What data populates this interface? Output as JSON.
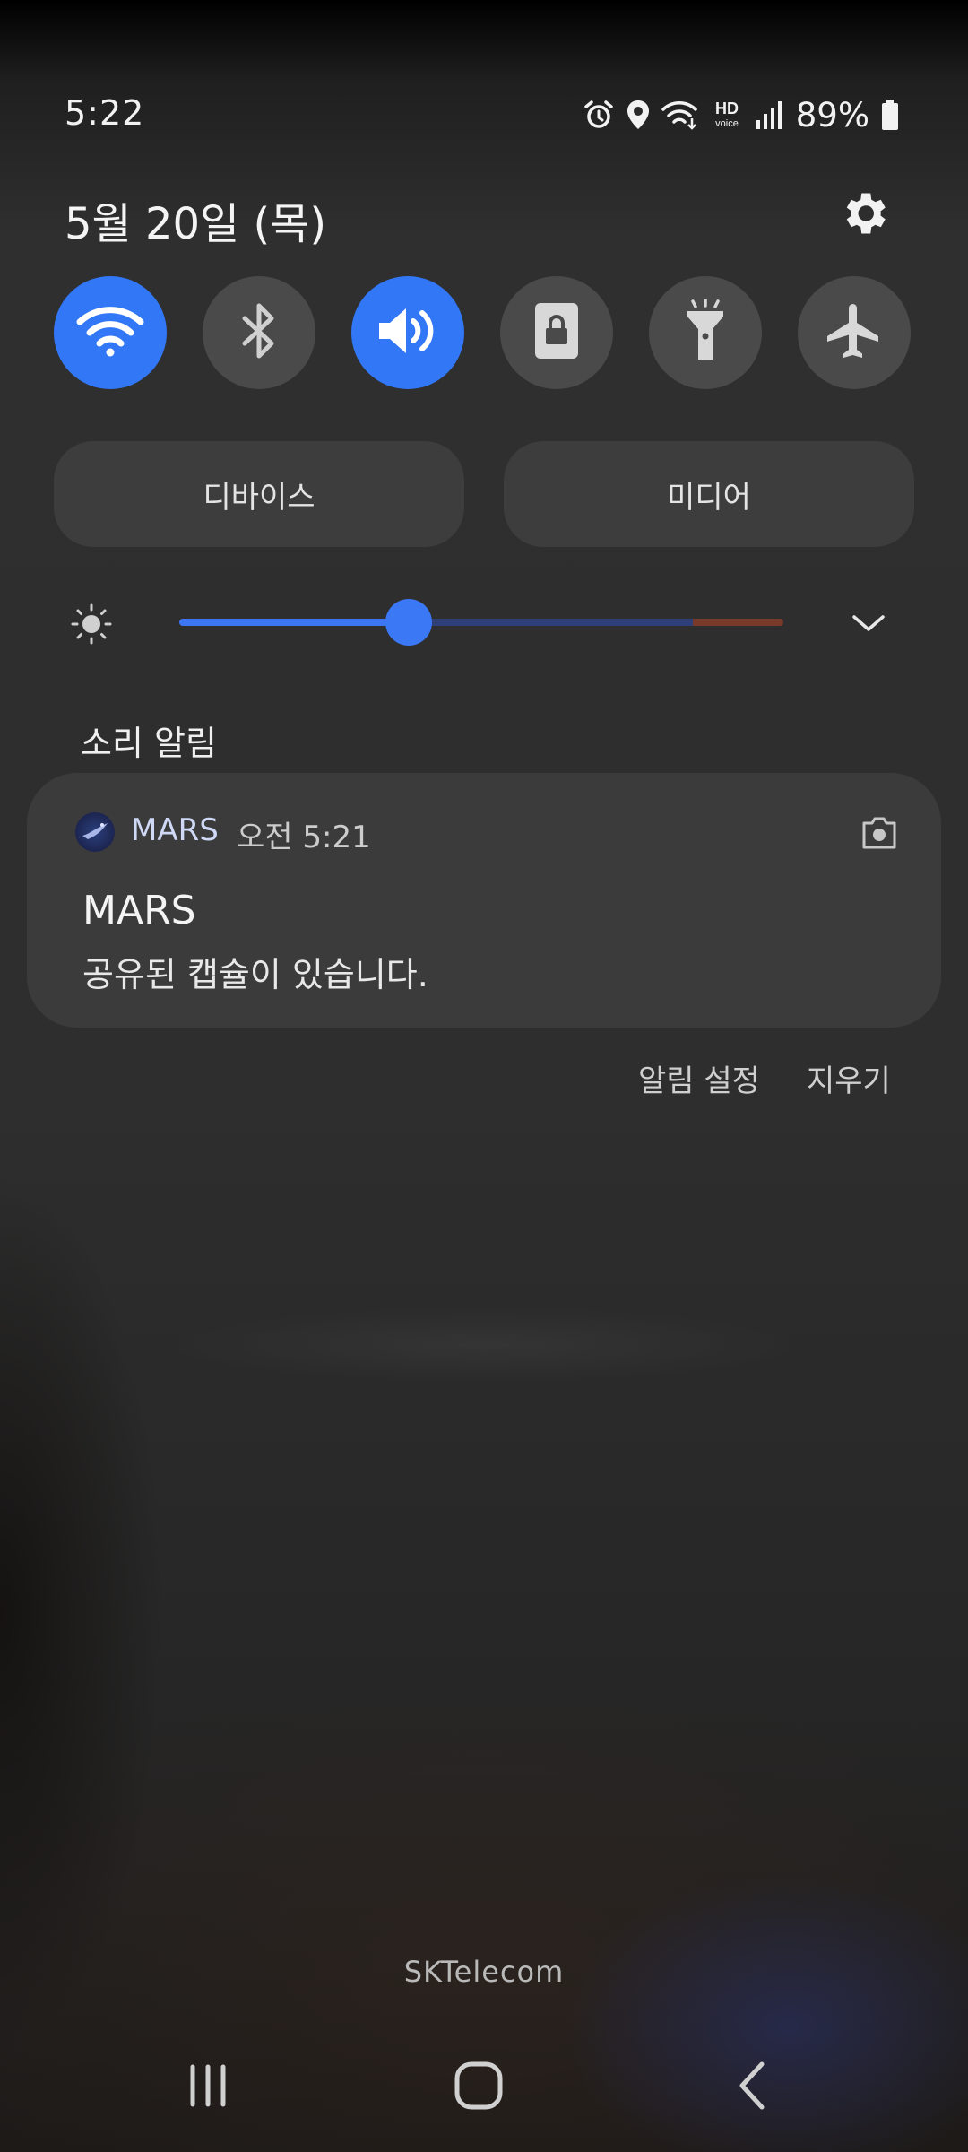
{
  "status_bar": {
    "time": "5:22",
    "battery": "89%",
    "icons": [
      "alarm-icon",
      "location-icon",
      "wifi-calling-icon",
      "hd-voice-icon",
      "signal-icon",
      "battery-icon"
    ]
  },
  "header": {
    "date": "5월 20일 (목)",
    "settings_icon": "gear-icon"
  },
  "quick_toggles": [
    {
      "name": "wifi",
      "icon": "wifi-icon",
      "on": true
    },
    {
      "name": "bluetooth",
      "icon": "bluetooth-icon",
      "on": false
    },
    {
      "name": "sound",
      "icon": "sound-icon",
      "on": true
    },
    {
      "name": "screen-lock",
      "icon": "lock-rotation-icon",
      "on": false
    },
    {
      "name": "flashlight",
      "icon": "flashlight-icon",
      "on": false
    },
    {
      "name": "airplane",
      "icon": "airplane-icon",
      "on": false
    }
  ],
  "panel_buttons": {
    "devices": "디바이스",
    "media": "미디어"
  },
  "brightness": {
    "level": 0.38,
    "icon": "brightness-icon",
    "expand_icon": "chevron-down-icon"
  },
  "notifications": {
    "section_label": "소리 알림",
    "items": [
      {
        "app": "MARS",
        "time": "오전 5:21",
        "title": "MARS",
        "text": "공유된 캡슐이 있습니다.",
        "icon": "camera-icon"
      }
    ],
    "settings_label": "알림 설정",
    "clear_label": "지우기"
  },
  "carrier": "SKTelecom",
  "colors": {
    "accent": "#3277f5",
    "tile_off": "#4a4a4a",
    "card": "#3b3b3b"
  }
}
